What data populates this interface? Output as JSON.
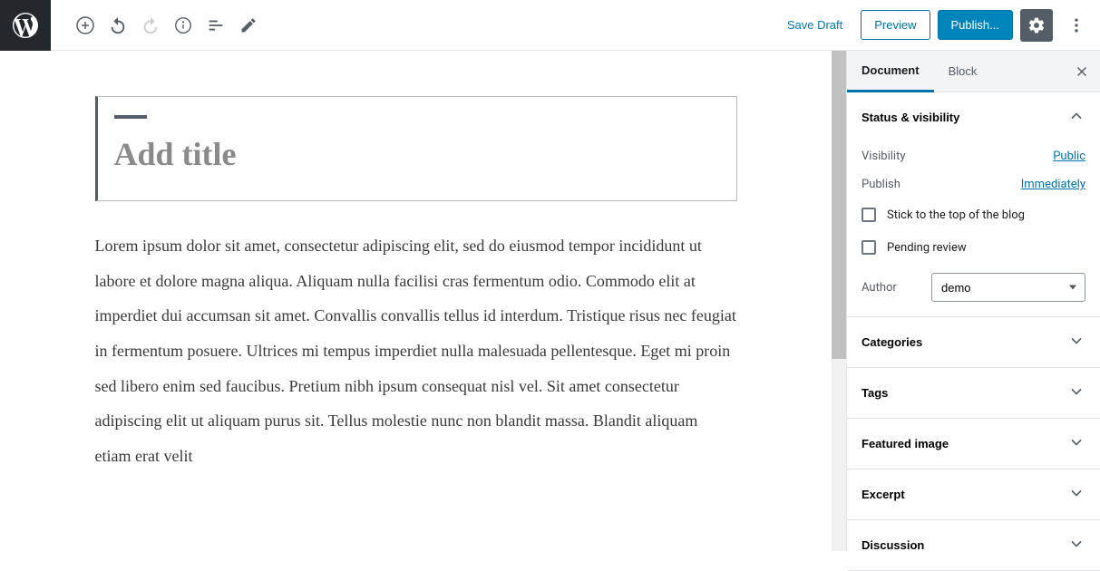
{
  "toolbar": {
    "save_draft": "Save Draft",
    "preview": "Preview",
    "publish": "Publish..."
  },
  "editor": {
    "title_placeholder": "Add title",
    "content": "Lorem ipsum dolor sit amet, consectetur adipiscing elit, sed do eiusmod tempor incididunt ut labore et dolore magna aliqua. Aliquam nulla facilisi cras fermentum odio. Commodo elit at imperdiet dui accumsan sit amet. Convallis convallis tellus id interdum. Tristique risus nec feugiat in fermentum posuere. Ultrices mi tempus imperdiet nulla malesuada pellentesque. Eget mi proin sed libero enim sed faucibus. Pretium nibh ipsum consequat nisl vel. Sit amet consectetur adipiscing elit ut aliquam purus sit. Tellus molestie nunc non blandit massa. Blandit aliquam etiam erat velit"
  },
  "sidebar": {
    "tabs": {
      "document": "Document",
      "block": "Block"
    },
    "status": {
      "header": "Status & visibility",
      "visibility_label": "Visibility",
      "visibility_value": "Public",
      "publish_label": "Publish",
      "publish_value": "Immediately",
      "stick_top": "Stick to the top of the blog",
      "pending": "Pending review",
      "author_label": "Author",
      "author_value": "demo"
    },
    "panels": {
      "categories": "Categories",
      "tags": "Tags",
      "featured_image": "Featured image",
      "excerpt": "Excerpt",
      "discussion": "Discussion"
    }
  }
}
